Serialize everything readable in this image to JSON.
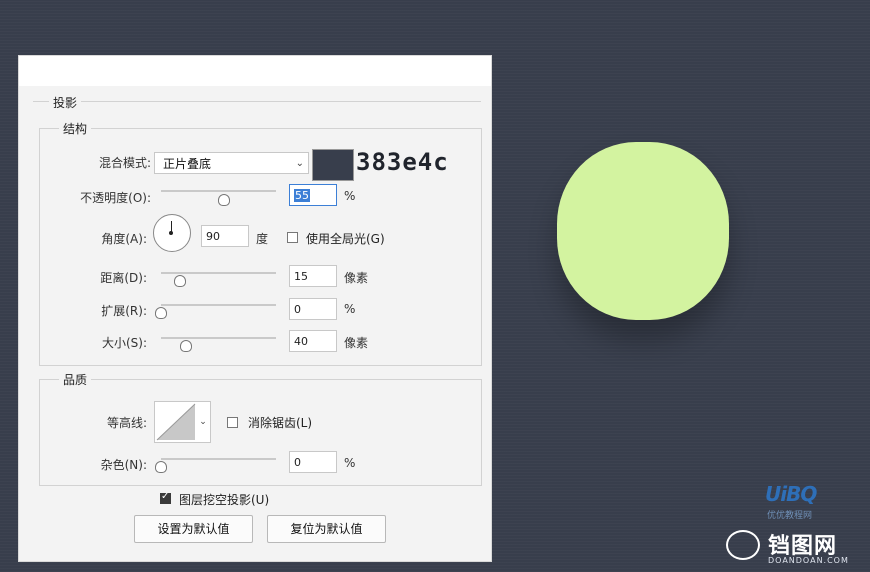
{
  "canvas": {
    "background_color": "#383e4c",
    "shape_color": "#d3f3a0"
  },
  "dialog": {
    "section_title": "投影",
    "structure": {
      "legend": "结构",
      "blend_mode_label": "混合模式:",
      "blend_mode_value": "正片叠底",
      "color_swatch_hex": "#383e4c",
      "color_note": "383e4c",
      "opacity_label": "不透明度(O):",
      "opacity_value": "55",
      "opacity_unit": "%",
      "opacity_slider_fraction": 0.55,
      "angle_label": "角度(A):",
      "angle_value": "90",
      "angle_unit": "度",
      "global_light_label": "使用全局光(G)",
      "global_light_checked": false,
      "distance_label": "距离(D):",
      "distance_value": "15",
      "distance_unit": "像素",
      "spread_label": "扩展(R):",
      "spread_value": "0",
      "spread_unit": "%",
      "size_label": "大小(S):",
      "size_value": "40",
      "size_unit": "像素"
    },
    "quality": {
      "legend": "品质",
      "contour_label": "等高线:",
      "anti_alias_label": "消除锯齿(L)",
      "anti_alias_checked": false,
      "noise_label": "杂色(N):",
      "noise_value": "0",
      "noise_unit": "%"
    },
    "knockout_label": "图层挖空投影(U)",
    "knockout_checked": true,
    "buttons": {
      "set_default": "设置为默认值",
      "reset_default": "复位为默认值"
    }
  },
  "watermarks": {
    "left_big": "UiBQ",
    "left_small": "优优教程网",
    "right_cn": "铛图网",
    "right_en": "DOANDOAN.COM"
  }
}
